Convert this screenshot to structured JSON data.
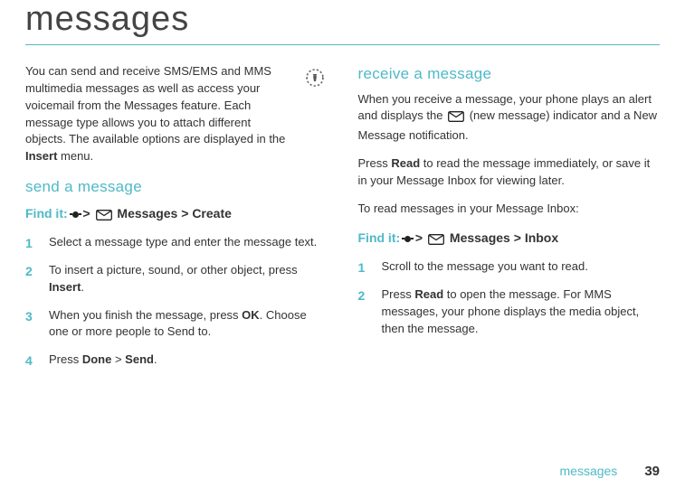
{
  "pageTitle": "messages",
  "intro": {
    "textBefore": "You can send and receive SMS/EMS and MMS multimedia messages as well as access your voicemail from the Messages feature. Each message type allows you to attach different objects. The available options are displayed in the ",
    "insertLabel": "Insert",
    "textAfter": " menu."
  },
  "send": {
    "heading": "send a message",
    "findItLabel": "Find it:  ",
    "pathSep": " > ",
    "messagesLabel": " Messages",
    "createLabel": "Create",
    "steps": {
      "s1": "Select a message type and enter the message text.",
      "s2a": "To insert a picture, sound, or other object, press ",
      "s2b": "Insert",
      "s2c": ".",
      "s3a": "When you finish the message, press ",
      "s3b": "OK",
      "s3c": ". Choose one or more people to Send to.",
      "s4a": "Press ",
      "s4b": "Done",
      "s4c": " > ",
      "s4d": "Send",
      "s4e": "."
    }
  },
  "receive": {
    "heading": "receive a message",
    "p1a": "When you receive a message, your phone plays an alert and displays the ",
    "p1b": " (new message) indicator and a New Message notification.",
    "p2a": "Press ",
    "p2b": "Read",
    "p2c": " to read the message immediately, or save it in your Message Inbox for viewing later.",
    "p3": "To read messages in your Message Inbox:",
    "findItLabel": "Find it:  ",
    "pathSep": " > ",
    "messagesLabel": " Messages",
    "inboxLabel": "Inbox",
    "steps": {
      "s1": "Scroll to the message you want to read.",
      "s2a": "Press ",
      "s2b": "Read",
      "s2c": " to open the message. For MMS messages, your phone displays the media object, then the message."
    }
  },
  "footer": {
    "label": "messages",
    "page": "39"
  }
}
